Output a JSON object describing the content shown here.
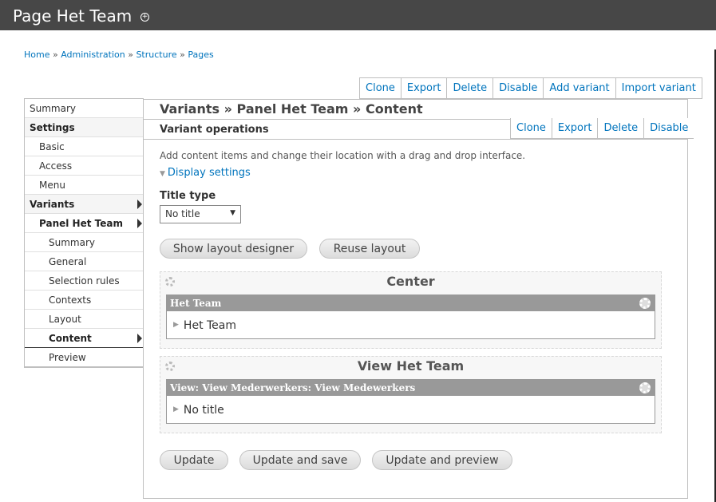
{
  "header": {
    "title": "Page Het Team",
    "shortcut_icon": "plus-circle-icon"
  },
  "breadcrumb": [
    "Home",
    "Administration",
    "Structure",
    "Pages"
  ],
  "breadcrumb_sep": "»",
  "page_ops": [
    "Clone",
    "Export",
    "Delete",
    "Disable",
    "Add variant",
    "Import variant"
  ],
  "sidebar": {
    "items": [
      {
        "label": "Summary",
        "level": 0,
        "bold": false
      },
      {
        "label": "Settings",
        "level": 0,
        "bold": true
      },
      {
        "label": "Basic",
        "level": 1,
        "bold": false
      },
      {
        "label": "Access",
        "level": 1,
        "bold": false
      },
      {
        "label": "Menu",
        "level": 1,
        "bold": false
      },
      {
        "label": "Variants",
        "level": 0,
        "bold": true,
        "arrow": true
      },
      {
        "label": "Panel Het Team",
        "level": 1,
        "bold": true,
        "arrow": true
      },
      {
        "label": "Summary",
        "level": 2,
        "bold": false
      },
      {
        "label": "General",
        "level": 2,
        "bold": false
      },
      {
        "label": "Selection rules",
        "level": 2,
        "bold": false
      },
      {
        "label": "Contexts",
        "level": 2,
        "bold": false
      },
      {
        "label": "Layout",
        "level": 2,
        "bold": false
      },
      {
        "label": "Content",
        "level": 2,
        "bold": true,
        "arrow": true,
        "active": true
      },
      {
        "label": "Preview",
        "level": 2,
        "bold": false
      }
    ]
  },
  "main": {
    "title": "Variants » Panel Het Team » Content",
    "variant_ops_label": "Variant operations",
    "variant_ops": [
      "Clone",
      "Export",
      "Delete",
      "Disable"
    ],
    "description": "Add content items and change their location with a drag and drop interface.",
    "display_settings": "Display settings",
    "title_type_label": "Title type",
    "title_type_value": "No title",
    "show_layout_designer": "Show layout designer",
    "reuse_layout": "Reuse layout",
    "regions": [
      {
        "title": "Center",
        "pane_bar": "Het Team",
        "pane_body": "Het Team"
      },
      {
        "title": "View Het Team",
        "pane_bar": "View: View Mederwerkers: View Medewerkers",
        "pane_body": "No title"
      }
    ],
    "buttons": {
      "update": "Update",
      "update_save": "Update and save",
      "update_preview": "Update and preview"
    }
  }
}
